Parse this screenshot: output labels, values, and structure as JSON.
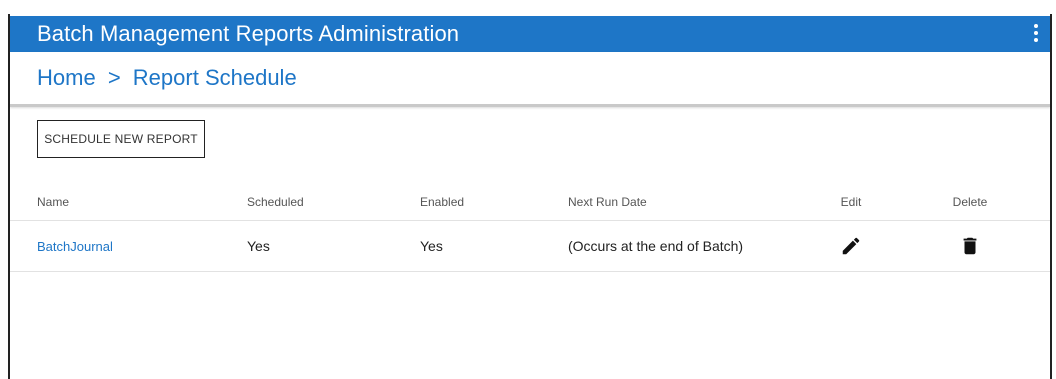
{
  "app": {
    "title": "Batch Management Reports Administration",
    "menu_icon": "kebab-menu-icon"
  },
  "breadcrumb": {
    "home": "Home",
    "separator": ">",
    "current": "Report Schedule"
  },
  "actions": {
    "schedule_new_label": "SCHEDULE NEW REPORT"
  },
  "table": {
    "headers": {
      "name": "Name",
      "scheduled": "Scheduled",
      "enabled": "Enabled",
      "next_run": "Next Run Date",
      "edit": "Edit",
      "delete": "Delete"
    },
    "rows": [
      {
        "name": "BatchJournal",
        "scheduled": "Yes",
        "enabled": "Yes",
        "next_run": "(Occurs at the end of Batch)",
        "edit_icon": "pencil-icon",
        "delete_icon": "trash-icon"
      }
    ]
  },
  "colors": {
    "header_bg": "#1e76c7",
    "link": "#1e76c7"
  }
}
